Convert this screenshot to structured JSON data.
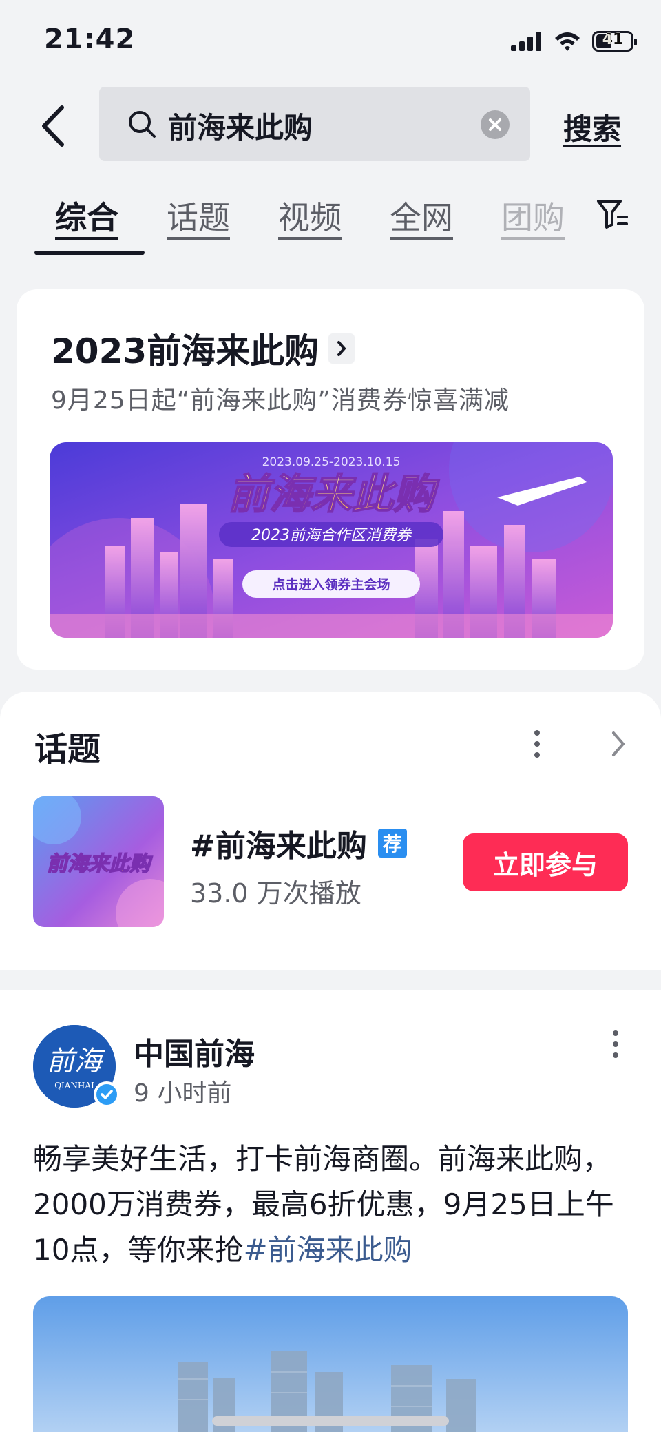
{
  "status_bar": {
    "time": "21:42",
    "battery": "41"
  },
  "search": {
    "query": "前海来此购",
    "action_label": "搜索"
  },
  "tabs": [
    {
      "label": "综合",
      "active": true
    },
    {
      "label": "话题"
    },
    {
      "label": "视频"
    },
    {
      "label": "全网"
    },
    {
      "label": "团购"
    }
  ],
  "promo": {
    "title": "2023前海来此购",
    "subtitle": "9月25日起“前海来此购”消费券惊喜满减",
    "banner": {
      "date_range": "2023.09.25-2023.10.15",
      "headline": "前海来此购",
      "tagline": "2023前海合作区消费券",
      "cta": "点击进入领券主会场"
    }
  },
  "topic_section": {
    "heading": "话题",
    "thumb_text": "前海来此购",
    "topic_name": "#前海来此购",
    "badge": "荐",
    "plays": "33.0 万次播放",
    "join_label": "立即参与"
  },
  "post": {
    "avatar_text": "前海",
    "avatar_sub": "QIANHAI",
    "author": "中国前海",
    "time": "9 小时前",
    "text": "畅享美好生活，打卡前海商圈。前海来此购，2000万消费券，最高6折优惠，9月25日上午10点，等你来抢",
    "hashtag": "#前海来此购"
  },
  "colors": {
    "primary_red": "#fe2c55",
    "badge_blue": "#2a8ef0",
    "hashtag_blue": "#3b5b8f"
  }
}
